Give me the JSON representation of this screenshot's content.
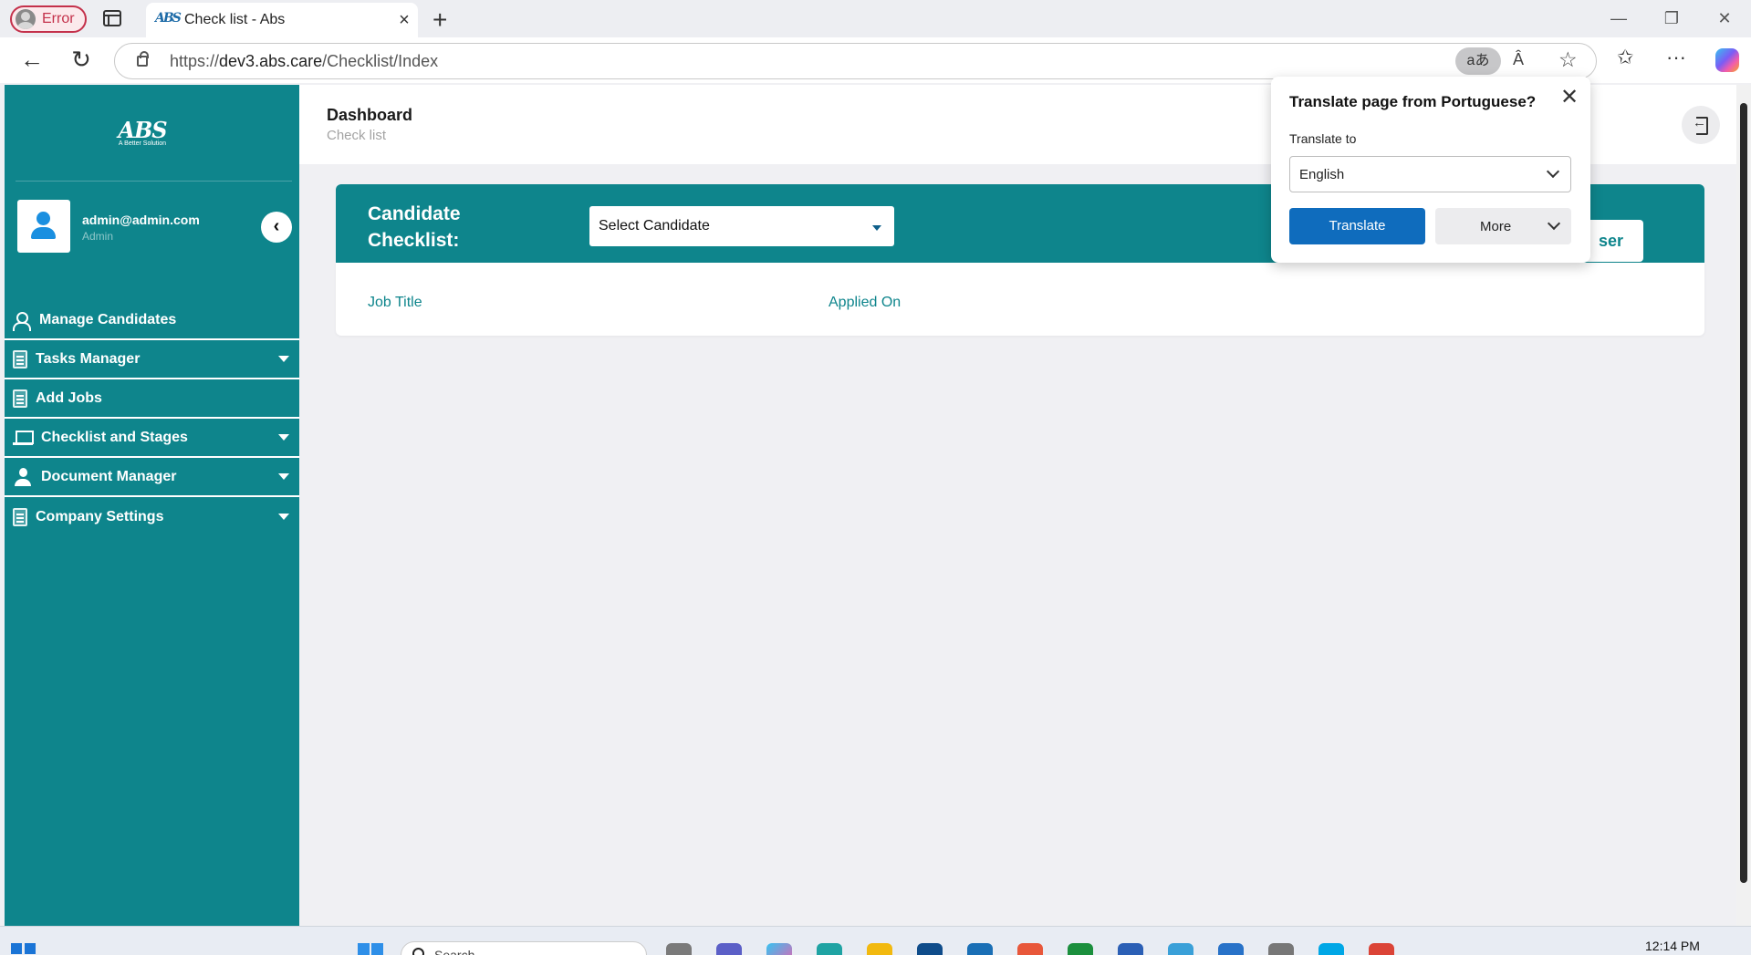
{
  "browser": {
    "profile_label": "Error",
    "tab_title": "Check list - Abs",
    "tab_close": "×",
    "new_tab": "+",
    "url_prefix": "https://",
    "url_host": "dev3.abs.care",
    "url_path": "/Checklist/Index",
    "translate_pill": "aあ",
    "read_aloud": "Â",
    "favorite_star": "☆",
    "favorites_icon": "✩",
    "more_icon": "···",
    "window_controls": [
      "—",
      "❐",
      "✕"
    ],
    "back": "←",
    "refresh": "↻"
  },
  "sidebar": {
    "logo_text": "ABS",
    "logo_tagline": "A Better Solution",
    "user_email": "admin@admin.com",
    "user_role": "Admin",
    "collapse_icon": "‹",
    "menu": [
      {
        "label": "Manage Candidates",
        "icon": "people-icon",
        "has_submenu": false
      },
      {
        "label": "Tasks Manager",
        "icon": "document-icon",
        "has_submenu": true
      },
      {
        "label": "Add Jobs",
        "icon": "document-icon",
        "has_submenu": false
      },
      {
        "label": "Checklist and Stages",
        "icon": "laptop-icon",
        "has_submenu": true
      },
      {
        "label": "Document Manager",
        "icon": "person-icon",
        "has_submenu": true
      },
      {
        "label": "Company Settings",
        "icon": "document-icon",
        "has_submenu": true
      }
    ]
  },
  "header": {
    "title": "Dashboard",
    "breadcrumb": "Check list"
  },
  "checklist": {
    "title": "Candidate Checklist:",
    "select_placeholder": "Select Candidate",
    "add_user_partial": "ser",
    "columns": [
      "Job Title",
      "Applied On"
    ]
  },
  "translate_popup": {
    "title": "Translate page from Portuguese?",
    "close": "✕",
    "translate_to_label": "Translate to",
    "language": "English",
    "translate_button": "Translate",
    "more_button": "More"
  },
  "taskbar": {
    "search_text": "Search",
    "clock": "12:14 PM"
  },
  "colors": {
    "brand_teal": "#0e858c",
    "translate_blue": "#0f6cbd",
    "error_red": "#c4314b"
  }
}
